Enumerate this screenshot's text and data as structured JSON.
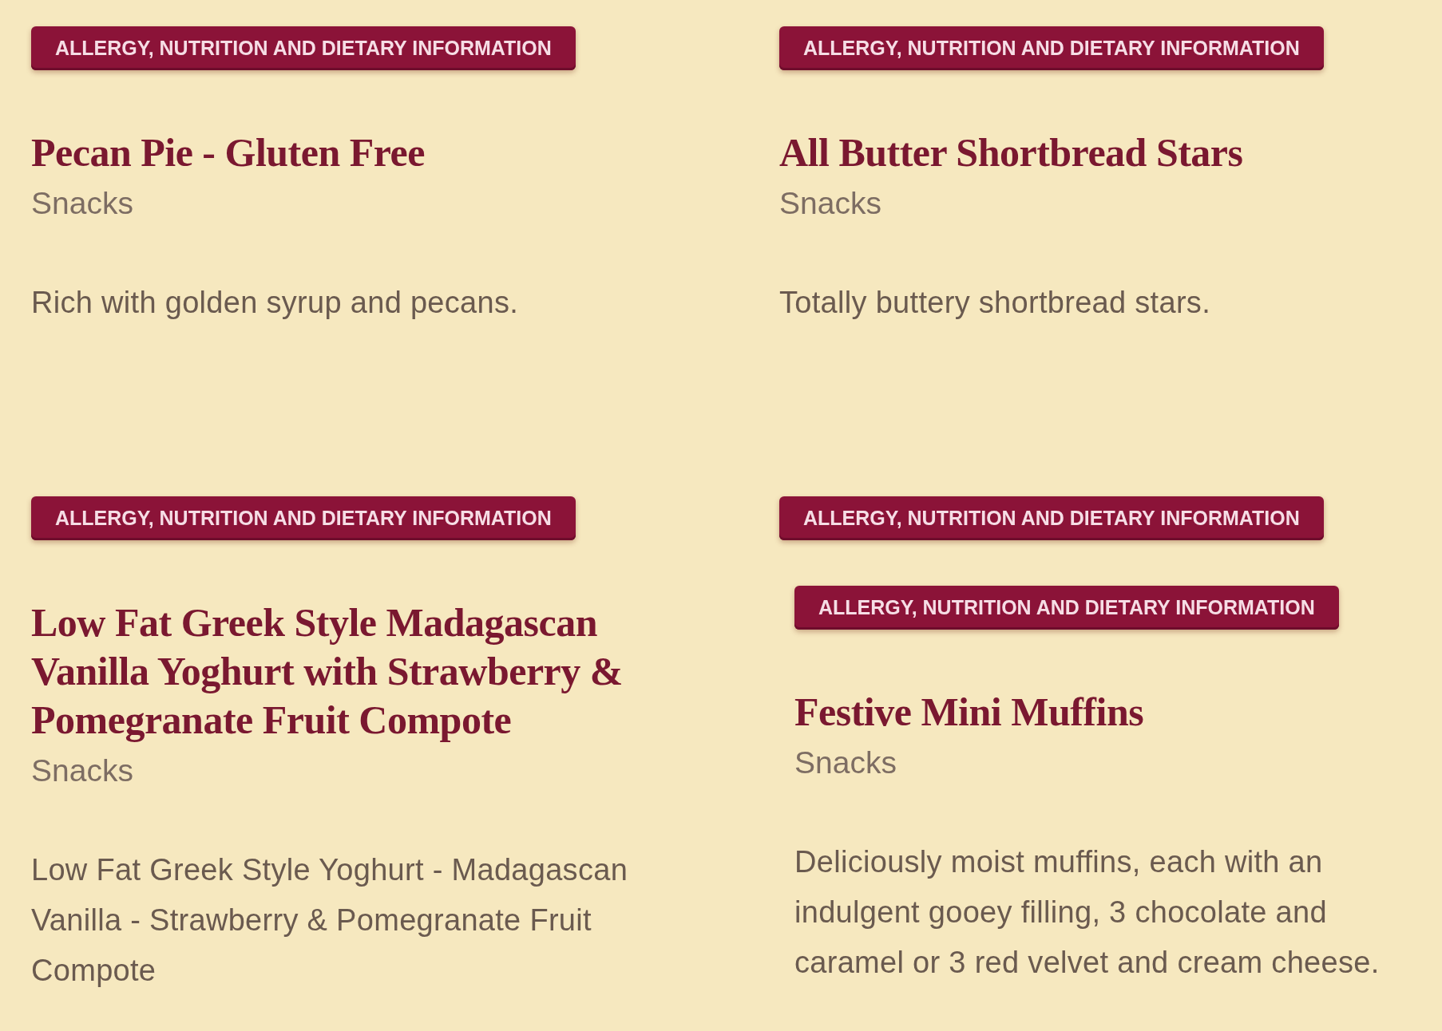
{
  "products": [
    {
      "info_button": "ALLERGY, NUTRITION AND DIETARY INFORMATION",
      "title": "Pecan Pie - Gluten Free",
      "category": "Snacks",
      "description": "Rich with golden syrup and pecans."
    },
    {
      "info_button": "ALLERGY, NUTRITION AND DIETARY INFORMATION",
      "title": "All Butter Shortbread Stars",
      "category": "Snacks",
      "description": "Totally buttery shortbread stars."
    },
    {
      "info_button": "ALLERGY, NUTRITION AND DIETARY INFORMATION",
      "title": "Low Fat Greek Style Madagascan Vanilla Yoghurt with Strawberry & Pomegranate Fruit Compote",
      "category": "Snacks",
      "description": "Low Fat Greek Style Yoghurt - Madagascan Vanilla - Strawberry & Pomegranate Fruit Compote"
    },
    {
      "info_button": "ALLERGY, NUTRITION AND DIETARY INFORMATION",
      "children": [
        {
          "info_button": "ALLERGY, NUTRITION AND DIETARY INFORMATION",
          "title": "Festive Mini Muffins",
          "category": "Snacks",
          "description": "Deliciously moist muffins, each with an indulgent gooey filling, 3 chocolate and caramel or 3 red velvet and cream cheese."
        }
      ]
    }
  ]
}
